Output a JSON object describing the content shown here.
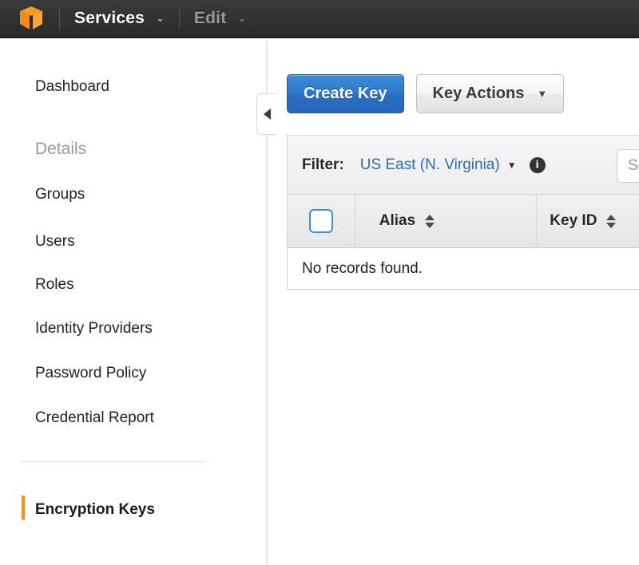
{
  "navbar": {
    "logo_icon": "aws-cube-logo",
    "services_label": "Services",
    "services_caret": "⌄",
    "edit_label": "Edit",
    "edit_caret": "⌄"
  },
  "sidebar": {
    "items": [
      {
        "label": "Dashboard",
        "state": "normal"
      },
      {
        "label": "Details",
        "state": "muted"
      },
      {
        "label": "Groups",
        "state": "normal"
      },
      {
        "label": "Users",
        "state": "normal"
      },
      {
        "label": "Roles",
        "state": "normal"
      },
      {
        "label": "Identity Providers",
        "state": "normal"
      },
      {
        "label": "Password Policy",
        "state": "normal"
      },
      {
        "label": "Credential Report",
        "state": "normal"
      },
      {
        "label": "Encryption Keys",
        "state": "active"
      }
    ],
    "collapse_icon": "collapse-left-triangle-icon",
    "active_accent_color": "#f29111"
  },
  "toolbar": {
    "create_key_label": "Create Key",
    "key_actions_label": "Key Actions",
    "key_actions_caret": "▼",
    "primary_color": "#2f76c9"
  },
  "filter": {
    "label": "Filter:",
    "region_value": "US East (N. Virginia)",
    "region_caret": "▼",
    "info_icon": "info-circle-icon",
    "info_glyph": "i",
    "link_color": "#2a6ebb",
    "search_placeholder": "Search",
    "search_value": ""
  },
  "table": {
    "columns": [
      {
        "label": "Alias",
        "sortable": true
      },
      {
        "label": "Key ID",
        "sortable": true
      }
    ],
    "select_all_checked": false,
    "rows": [],
    "empty_message": "No records found."
  }
}
